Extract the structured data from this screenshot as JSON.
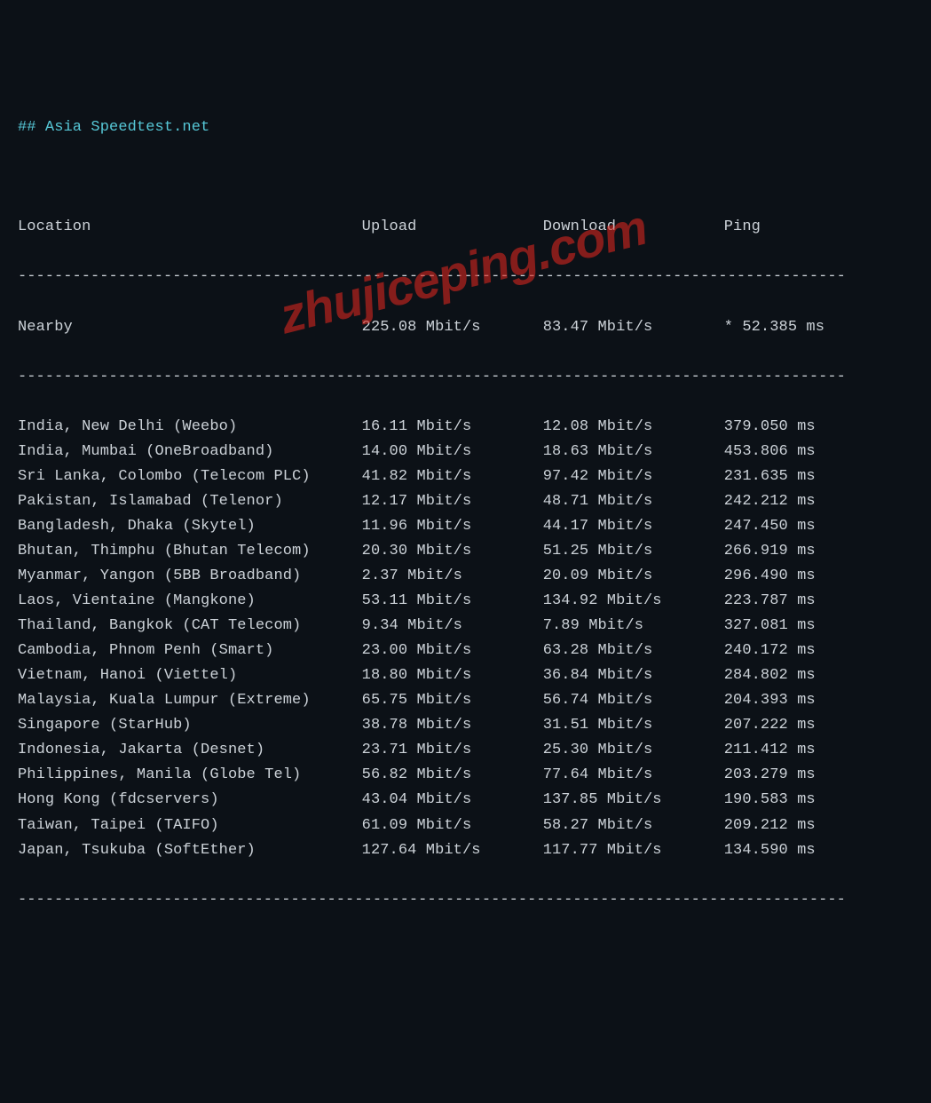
{
  "title": "## Asia Speedtest.net",
  "headers": {
    "location": "Location",
    "upload": "Upload",
    "download": "Download",
    "ping": "Ping"
  },
  "nearby": {
    "location": "Nearby",
    "upload": "225.08 Mbit/s",
    "download": "83.47 Mbit/s",
    "ping": "* 52.385 ms"
  },
  "rows": [
    {
      "location": "India, New Delhi (Weebo)",
      "upload": "16.11 Mbit/s",
      "download": "12.08 Mbit/s",
      "ping": "379.050 ms"
    },
    {
      "location": "India, Mumbai (OneBroadband)",
      "upload": "14.00 Mbit/s",
      "download": "18.63 Mbit/s",
      "ping": "453.806 ms"
    },
    {
      "location": "Sri Lanka, Colombo (Telecom PLC)",
      "upload": "41.82 Mbit/s",
      "download": "97.42 Mbit/s",
      "ping": "231.635 ms"
    },
    {
      "location": "Pakistan, Islamabad (Telenor)",
      "upload": "12.17 Mbit/s",
      "download": "48.71 Mbit/s",
      "ping": "242.212 ms"
    },
    {
      "location": "Bangladesh, Dhaka (Skytel)",
      "upload": "11.96 Mbit/s",
      "download": "44.17 Mbit/s",
      "ping": "247.450 ms"
    },
    {
      "location": "Bhutan, Thimphu (Bhutan Telecom)",
      "upload": "20.30 Mbit/s",
      "download": "51.25 Mbit/s",
      "ping": "266.919 ms"
    },
    {
      "location": "Myanmar, Yangon (5BB Broadband)",
      "upload": "2.37 Mbit/s",
      "download": "20.09 Mbit/s",
      "ping": "296.490 ms"
    },
    {
      "location": "Laos, Vientaine (Mangkone)",
      "upload": "53.11 Mbit/s",
      "download": "134.92 Mbit/s",
      "ping": "223.787 ms"
    },
    {
      "location": "Thailand, Bangkok (CAT Telecom)",
      "upload": "9.34 Mbit/s",
      "download": "7.89 Mbit/s",
      "ping": "327.081 ms"
    },
    {
      "location": "Cambodia, Phnom Penh (Smart)",
      "upload": "23.00 Mbit/s",
      "download": "63.28 Mbit/s",
      "ping": "240.172 ms"
    },
    {
      "location": "Vietnam, Hanoi (Viettel)",
      "upload": "18.80 Mbit/s",
      "download": "36.84 Mbit/s",
      "ping": "284.802 ms"
    },
    {
      "location": "Malaysia, Kuala Lumpur (Extreme)",
      "upload": "65.75 Mbit/s",
      "download": "56.74 Mbit/s",
      "ping": "204.393 ms"
    },
    {
      "location": "Singapore (StarHub)",
      "upload": "38.78 Mbit/s",
      "download": "31.51 Mbit/s",
      "ping": "207.222 ms"
    },
    {
      "location": "Indonesia, Jakarta (Desnet)",
      "upload": "23.71 Mbit/s",
      "download": "25.30 Mbit/s",
      "ping": "211.412 ms"
    },
    {
      "location": "Philippines, Manila (Globe Tel)",
      "upload": "56.82 Mbit/s",
      "download": "77.64 Mbit/s",
      "ping": "203.279 ms"
    },
    {
      "location": "Hong Kong (fdcservers)",
      "upload": "43.04 Mbit/s",
      "download": "137.85 Mbit/s",
      "ping": "190.583 ms"
    },
    {
      "location": "Taiwan, Taipei (TAIFO)",
      "upload": "61.09 Mbit/s",
      "download": "58.27 Mbit/s",
      "ping": "209.212 ms"
    },
    {
      "location": "Japan, Tsukuba (SoftEther)",
      "upload": "127.64 Mbit/s",
      "download": "117.77 Mbit/s",
      "ping": "134.590 ms"
    }
  ],
  "watermark": "zhujiceping.com",
  "dash_line": "-------------------------------------------------------------------------------------------"
}
